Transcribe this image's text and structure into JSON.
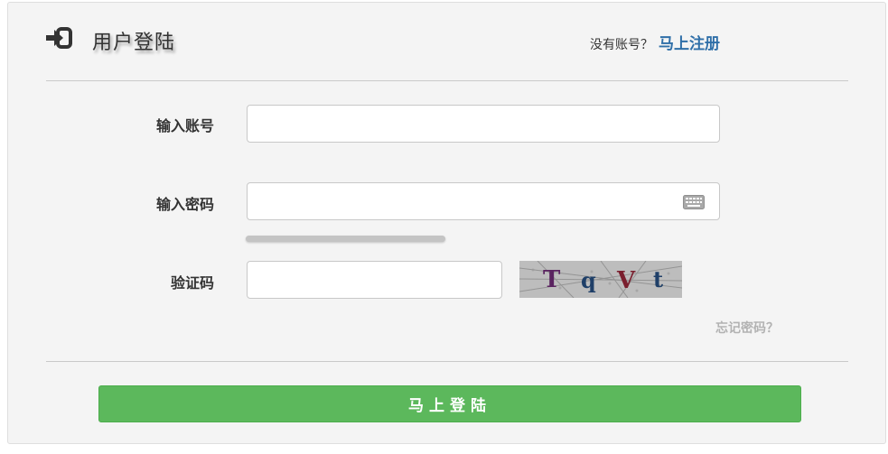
{
  "header": {
    "title": "用户登陆",
    "icon": "sign-in-icon"
  },
  "register": {
    "prompt": "没有账号？",
    "link_label": "马上注册"
  },
  "form": {
    "account": {
      "label": "输入账号",
      "value": "",
      "placeholder": ""
    },
    "password": {
      "label": "输入密码",
      "value": "",
      "placeholder": "",
      "icon": "keyboard-icon"
    },
    "captcha": {
      "label": "验证码",
      "value": "",
      "placeholder": "",
      "image_text": [
        "T",
        "q",
        "V",
        "t"
      ]
    }
  },
  "forgot_label": "忘记密码？",
  "login_button_label": "马上登陆",
  "colors": {
    "accent_button": "#5cb85c",
    "link": "#2f6fa8",
    "panel_bg": "#f4f4f4"
  }
}
